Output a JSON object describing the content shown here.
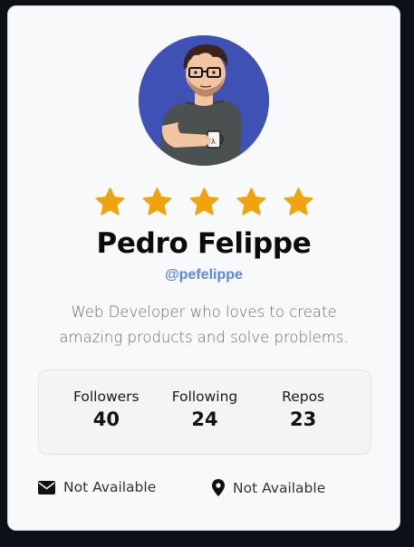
{
  "profile": {
    "name": "Pedro Felippe",
    "handle": "@pefelippe",
    "bio": "Web Developer who loves to create amazing products and solve problems.",
    "rating": 5,
    "rating_max": 5
  },
  "stats": [
    {
      "label": "Followers",
      "value": "40"
    },
    {
      "label": "Following",
      "value": "24"
    },
    {
      "label": "Repos",
      "value": "23"
    }
  ],
  "contact": {
    "email": {
      "icon": "envelope-icon",
      "text": "Not Available"
    },
    "location": {
      "icon": "map-pin-icon",
      "text": "Not Available"
    }
  },
  "colors": {
    "star": "#f0a30a",
    "handle": "#5b86e5",
    "avatar_bg": "#3f51b5",
    "card_bg": "#f8f9fb",
    "page_bg": "#0d1117"
  }
}
